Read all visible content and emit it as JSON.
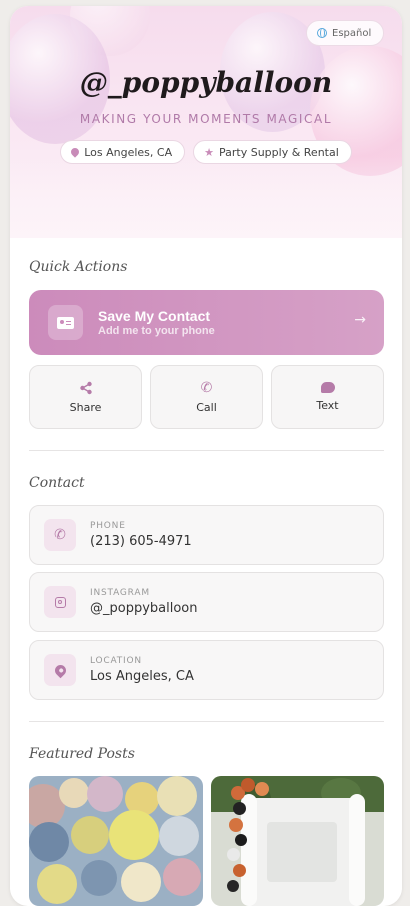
{
  "hero": {
    "language_button": "Español",
    "handle": "@_poppyballoon",
    "tagline": "MAKING YOUR MOMENTS MAGICAL",
    "chips": [
      {
        "icon": "location-pin-icon",
        "label": "Los Angeles, CA"
      },
      {
        "icon": "star-icon",
        "label": "Party Supply & Rental"
      }
    ]
  },
  "quick_actions": {
    "title": "Quick Actions",
    "save": {
      "title": "Save My Contact",
      "subtitle": "Add me to your phone",
      "icon": "contact-card-icon"
    },
    "buttons": [
      {
        "label": "Share",
        "icon": "share-icon"
      },
      {
        "label": "Call",
        "icon": "phone-icon"
      },
      {
        "label": "Text",
        "icon": "chat-bubble-icon"
      }
    ]
  },
  "contact": {
    "title": "Contact",
    "items": [
      {
        "label": "PHONE",
        "value": "(213) 605-4971",
        "icon": "phone-icon"
      },
      {
        "label": "INSTAGRAM",
        "value": "@_poppyballoon",
        "icon": "instagram-icon"
      },
      {
        "label": "LOCATION",
        "value": "Los Angeles, CA",
        "icon": "location-pin-icon"
      }
    ]
  },
  "featured": {
    "title": "Featured Posts"
  },
  "colors": {
    "accent": "#b57ba8",
    "save_gradient_start": "#cc8bbb",
    "save_gradient_end": "#d6a1c7",
    "tagline": "#b07aa8"
  }
}
